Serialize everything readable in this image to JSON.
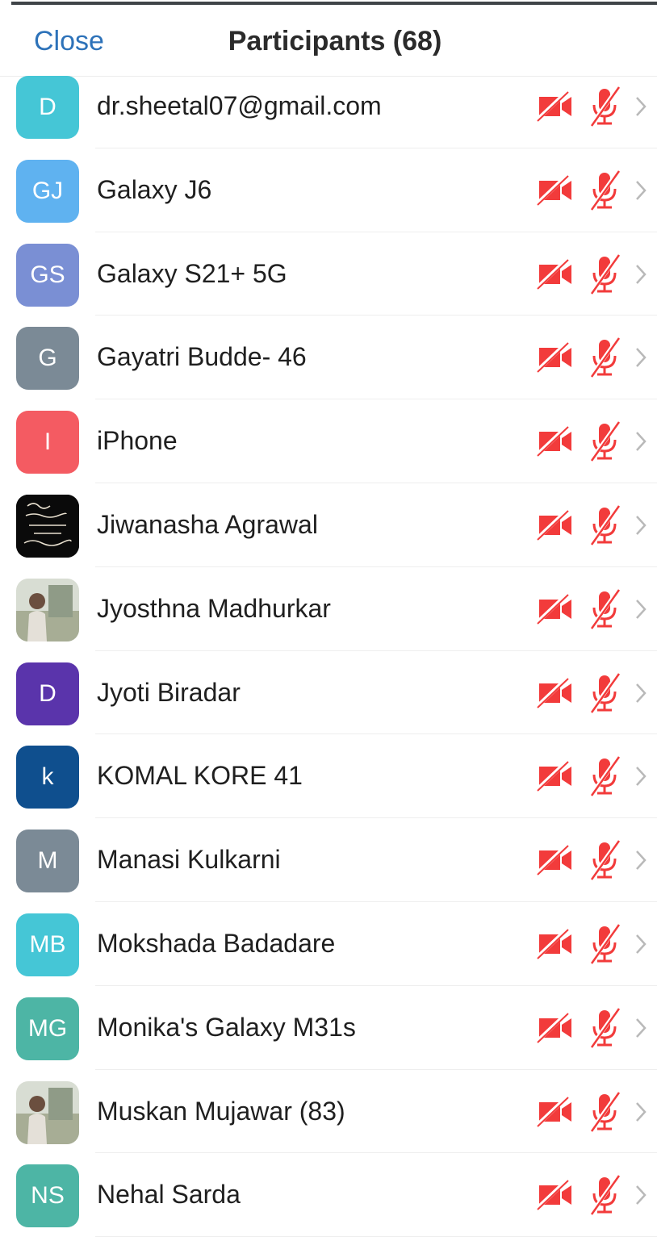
{
  "header": {
    "close_label": "Close",
    "title": "Participants (68)"
  },
  "colors": {
    "accent": "#2d72b9",
    "status_red": "#f23b3b"
  },
  "participants": [
    {
      "name": "dr.sheetal07@gmail.com",
      "initials": "D",
      "color": "#45c6d6",
      "video_icon": "video-off-icon",
      "mic_icon": "mic-muted-icon"
    },
    {
      "name": "Galaxy J6",
      "initials": "GJ",
      "color": "#5fb2f0",
      "video_icon": "video-off-icon",
      "mic_icon": "mic-muted-icon"
    },
    {
      "name": "Galaxy S21+ 5G",
      "initials": "GS",
      "color": "#7a8fd4",
      "video_icon": "video-off-icon",
      "mic_icon": "mic-muted-icon"
    },
    {
      "name": "Gayatri Budde- 46",
      "initials": "G",
      "color": "#7b8a96",
      "video_icon": "video-off-icon",
      "mic_icon": "mic-muted-icon"
    },
    {
      "name": "iPhone",
      "initials": "I",
      "color": "#f45b62",
      "video_icon": "video-off-icon",
      "mic_icon": "mic-muted-icon"
    },
    {
      "name": "Jiwanasha Agrawal",
      "initials": "",
      "avatar_type": "photo-dark",
      "video_icon": "video-off-icon",
      "mic_icon": "mic-muted-icon"
    },
    {
      "name": "Jyosthna Madhurkar",
      "initials": "",
      "avatar_type": "photo-light",
      "video_icon": "video-off-icon",
      "mic_icon": "mic-muted-icon"
    },
    {
      "name": "Jyoti Biradar",
      "initials": "D",
      "color": "#5a34ab",
      "video_icon": "video-off-icon",
      "mic_icon": "mic-muted-icon"
    },
    {
      "name": "KOMAL KORE 41",
      "initials": "k",
      "color": "#0f4f8e",
      "video_icon": "video-off-icon",
      "mic_icon": "mic-muted-icon"
    },
    {
      "name": "Manasi Kulkarni",
      "initials": "M",
      "color": "#7b8a96",
      "video_icon": "video-off-icon",
      "mic_icon": "mic-muted-icon"
    },
    {
      "name": "Mokshada Badadare",
      "initials": "MB",
      "color": "#45c6d6",
      "video_icon": "video-off-icon",
      "mic_icon": "mic-muted-icon"
    },
    {
      "name": "Monika's Galaxy M31s",
      "initials": "MG",
      "color": "#4db5a5",
      "video_icon": "video-off-icon",
      "mic_icon": "mic-muted-icon"
    },
    {
      "name": "Muskan Mujawar (83)",
      "initials": "",
      "avatar_type": "photo-light",
      "video_icon": "video-off-icon",
      "mic_icon": "mic-muted-icon"
    },
    {
      "name": "Nehal Sarda",
      "initials": "NS",
      "color": "#4db5a5",
      "video_icon": "video-off-icon",
      "mic_icon": "mic-muted-icon"
    }
  ]
}
